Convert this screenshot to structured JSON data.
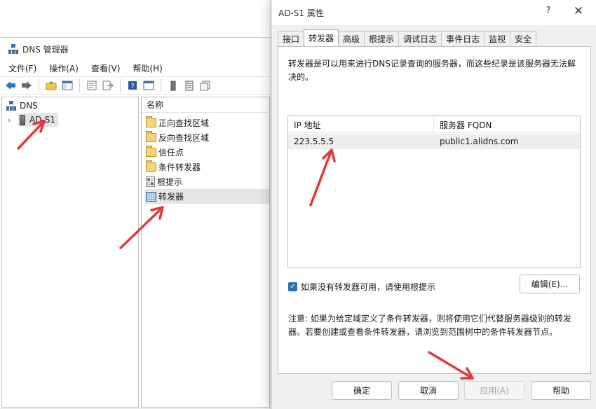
{
  "mmc": {
    "title": "DNS 管理器",
    "menu": [
      "文件(F)",
      "操作(A)",
      "查看(V)",
      "帮助(H)"
    ],
    "tree": {
      "root": "DNS",
      "server": "AD-S1"
    },
    "list_header": "名称",
    "list_items": [
      "正向查找区域",
      "反向查找区域",
      "信任点",
      "条件转发器",
      "根提示",
      "转发器"
    ]
  },
  "dialog": {
    "title": "AD-S1 属性",
    "help_glyph": "?",
    "close_glyph": "✕",
    "tabs": [
      "接口",
      "转发器",
      "高级",
      "根提示",
      "调试日志",
      "事件日志",
      "监视",
      "安全"
    ],
    "active_tab": "转发器",
    "description": "转发器是可以用来进行DNS记录查询的服务器，而这些纪录是该服务器无法解决的。",
    "table": {
      "columns": [
        "IP 地址",
        "服务器 FQDN"
      ],
      "rows": [
        [
          "223.5.5.5",
          "public1.alidns.com"
        ]
      ]
    },
    "use_root_hints_label": "如果没有转发器可用，请使用根提示",
    "use_root_hints_checked": true,
    "edit_button": "编辑(E)...",
    "note": "注意: 如果为给定域定义了条件转发器，则将使用它们代替服务器级别的转发器。若要创建或查看条件转发器，请浏览到范围树中的条件转发器节点。",
    "buttons": {
      "ok": "确定",
      "cancel": "取消",
      "apply": "应用(A)",
      "help": "帮助"
    }
  },
  "colors": {
    "accent": "#2f6fb6",
    "arrow": "#e0393e"
  }
}
